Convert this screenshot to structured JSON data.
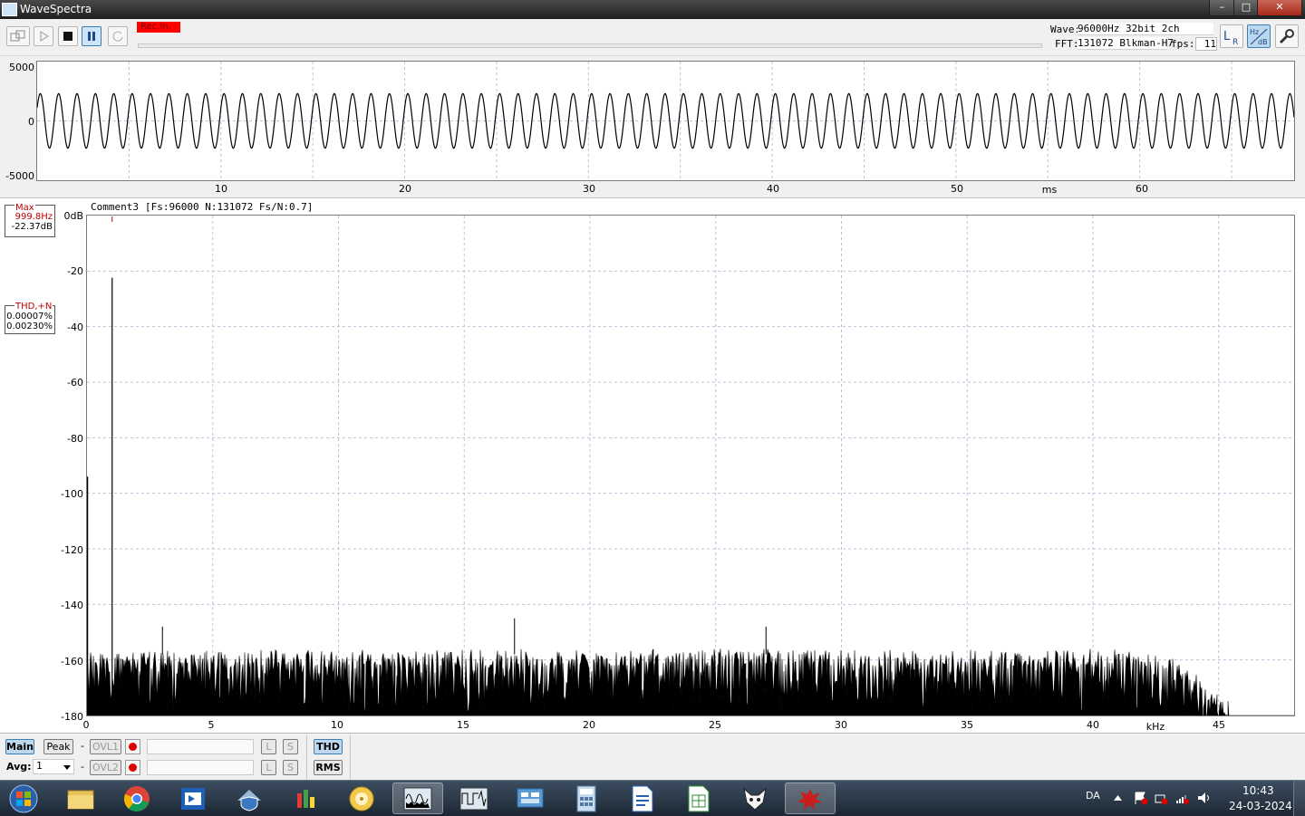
{
  "window": {
    "title": "WaveSpectra",
    "minimize": "–",
    "maximize": "□",
    "close": "✕"
  },
  "toolbar": {
    "rec_label": "Rec.In.",
    "wave_label": "Wave:",
    "wave_value": "96000Hz 32bit 2ch",
    "fft_label": "FFT:",
    "fft_value": "131072 Blkman-H7",
    "fps_label": "fps:",
    "fps_value": "11",
    "icons": [
      "loop-icon",
      "play-icon",
      "stop-icon",
      "pause-icon",
      "repeat-icon",
      "lr-channel-icon",
      "hz-db-icon",
      "settings-wrench-icon"
    ]
  },
  "wave": {
    "y_ticks": [
      "5000",
      "0",
      "-5000"
    ],
    "x_ticks": [
      "10",
      "20",
      "30",
      "40",
      "50",
      "60"
    ],
    "x_unit": "ms",
    "x_range_ms": [
      0,
      68.4
    ],
    "amplitude": 2300,
    "y_range": [
      -5000,
      5000
    ],
    "frequency_hz": 1000
  },
  "spectrum": {
    "comment": "Comment3",
    "params": "[Fs:96000 N:131072 Fs/N:0.7]",
    "max_label": "Max",
    "max_freq": "999.8Hz",
    "max_level": "-22.37dB",
    "thd_label": "THD,+N",
    "thd_value": "0.00007%",
    "thdn_value": "0.00230%",
    "y_ticks": [
      "0dB",
      "-20",
      "-40",
      "-60",
      "-80",
      "-100",
      "-120",
      "-140",
      "-160",
      "-180"
    ],
    "x_ticks": [
      "0",
      "5",
      "10",
      "15",
      "20",
      "25",
      "30",
      "35",
      "40",
      "45"
    ],
    "x_unit": "kHz",
    "x_range_khz": [
      0,
      48
    ],
    "y_range_db": [
      -180,
      0
    ],
    "peak_khz": 1.0,
    "peak_db": -22.37,
    "noise_floor_db": -160,
    "rolloff_start_khz": 42,
    "rolloff_end_khz": 45.4
  },
  "bottom": {
    "main": "Main",
    "peak": "Peak",
    "dash": "-",
    "ovl1": "OVL1",
    "ovl2": "OVL2",
    "l": "L",
    "s": "S",
    "thd": "THD",
    "rms": "RMS",
    "avg_label": "Avg:",
    "avg_value": "1"
  },
  "taskbar": {
    "lang": "DA",
    "time": "10:43",
    "date": "24-03-2024",
    "apps": [
      "windows-start-icon",
      "file-explorer-icon",
      "chrome-icon",
      "remote-app-icon",
      "network-shield-icon",
      "colors-app-icon",
      "cd-ripper-icon",
      "wavespectra-icon",
      "wavegene-icon",
      "control-panel-icon",
      "calculator-icon",
      "writer-doc-icon",
      "calc-sheet-icon",
      "fox-app-icon",
      "red-splat-icon"
    ]
  }
}
